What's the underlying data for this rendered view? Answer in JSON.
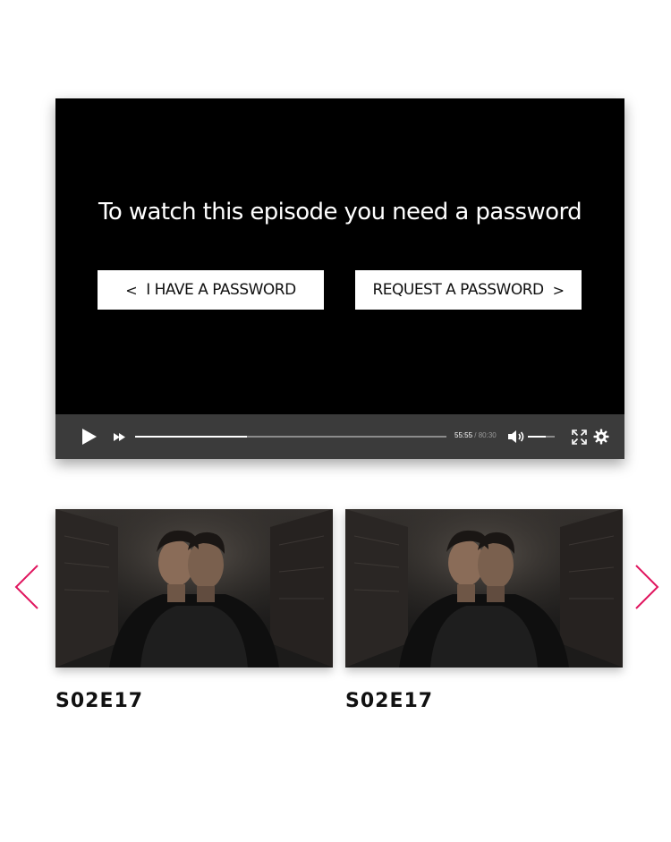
{
  "player": {
    "message": "To watch this episode you need a password",
    "have_password_label": "I HAVE A PASSWORD",
    "have_password_arrow": "<",
    "request_password_label": "REQUEST A PASSWORD",
    "request_password_arrow": ">",
    "controls": {
      "current_time": "55:55",
      "separator": " / ",
      "total_time": "80:30",
      "progress_fraction": 0.36,
      "volume_fraction": 0.65
    }
  },
  "carousel": {
    "items": [
      {
        "episode": "S02E17"
      },
      {
        "episode": "S02E17"
      }
    ]
  },
  "colors": {
    "accent": "#e0155e",
    "player_bg": "#000000",
    "controls_bg": "#3b3b3b"
  },
  "icons": [
    "play-icon",
    "fast-forward-icon",
    "volume-icon",
    "fullscreen-icon",
    "gear-icon",
    "chevron-left-icon",
    "chevron-right-icon"
  ]
}
